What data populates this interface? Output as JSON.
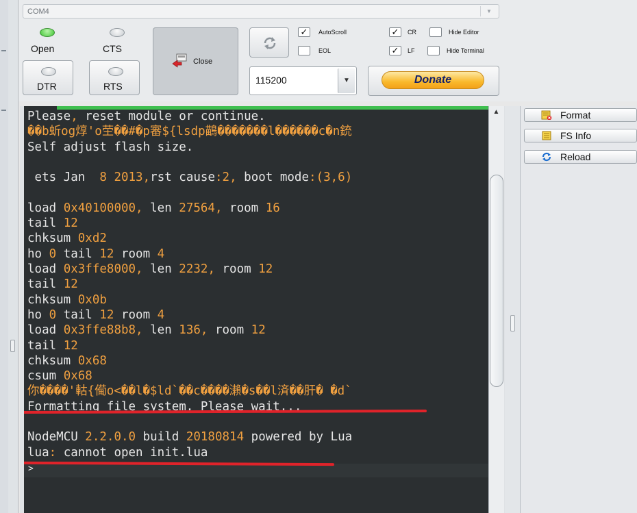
{
  "port": {
    "selected": "COM4"
  },
  "status": {
    "open_label": "Open",
    "cts_label": "CTS",
    "dtr_label": "DTR",
    "rts_label": "RTS",
    "open_led_color": "#3fc433"
  },
  "toolbar": {
    "close_label": "Close",
    "baud_value": "115200",
    "donate_label": "Donate"
  },
  "options": {
    "autoscroll": {
      "label": "AutoScroll",
      "checked": true
    },
    "eol": {
      "label": "EOL",
      "checked": false
    },
    "cr": {
      "label": "CR",
      "checked": true
    },
    "lf": {
      "label": "LF",
      "checked": true
    },
    "hide_editor": {
      "label": "Hide Editor",
      "checked": false
    },
    "hide_terminal": {
      "label": "Hide Terminal",
      "checked": false
    }
  },
  "side_buttons": {
    "format": "Format",
    "fs_info": "FS Info",
    "reload": "Reload"
  },
  "terminal": {
    "lines": [
      "Please, reset module or continue.",
      "��b蚚og焞'o茔��#�p審${lsdp鶓�������l������c�n銃",
      "Self adjust flash size.",
      "",
      " ets Jan  8 2013,rst cause:2, boot mode:(3,6)",
      "",
      "load 0x40100000, len 27564, room 16",
      "tail 12",
      "chksum 0xd2",
      "ho 0 tail 12 room 4",
      "load 0x3ffe8000, len 2232, room 12",
      "tail 12",
      "chksum 0x0b",
      "ho 0 tail 12 room 4",
      "load 0x3ffe88b8, len 136, room 12",
      "tail 12",
      "chksum 0x68",
      "csum 0x68",
      "你����'軲{僃o<��l�$ld`��c����瀨�s��l済��肝� �d`",
      "Formatting file system. Please wait...",
      "",
      "NodeMCU 2.2.0.0 build 20180814 powered by Lua",
      "lua: cannot open init.lua"
    ],
    "prompt": ">"
  },
  "colors": {
    "terminal_bg": "#2b2f31",
    "text_default": "#e6e6e6",
    "text_number": "#f0a040",
    "annotation_red": "#e0232a"
  }
}
